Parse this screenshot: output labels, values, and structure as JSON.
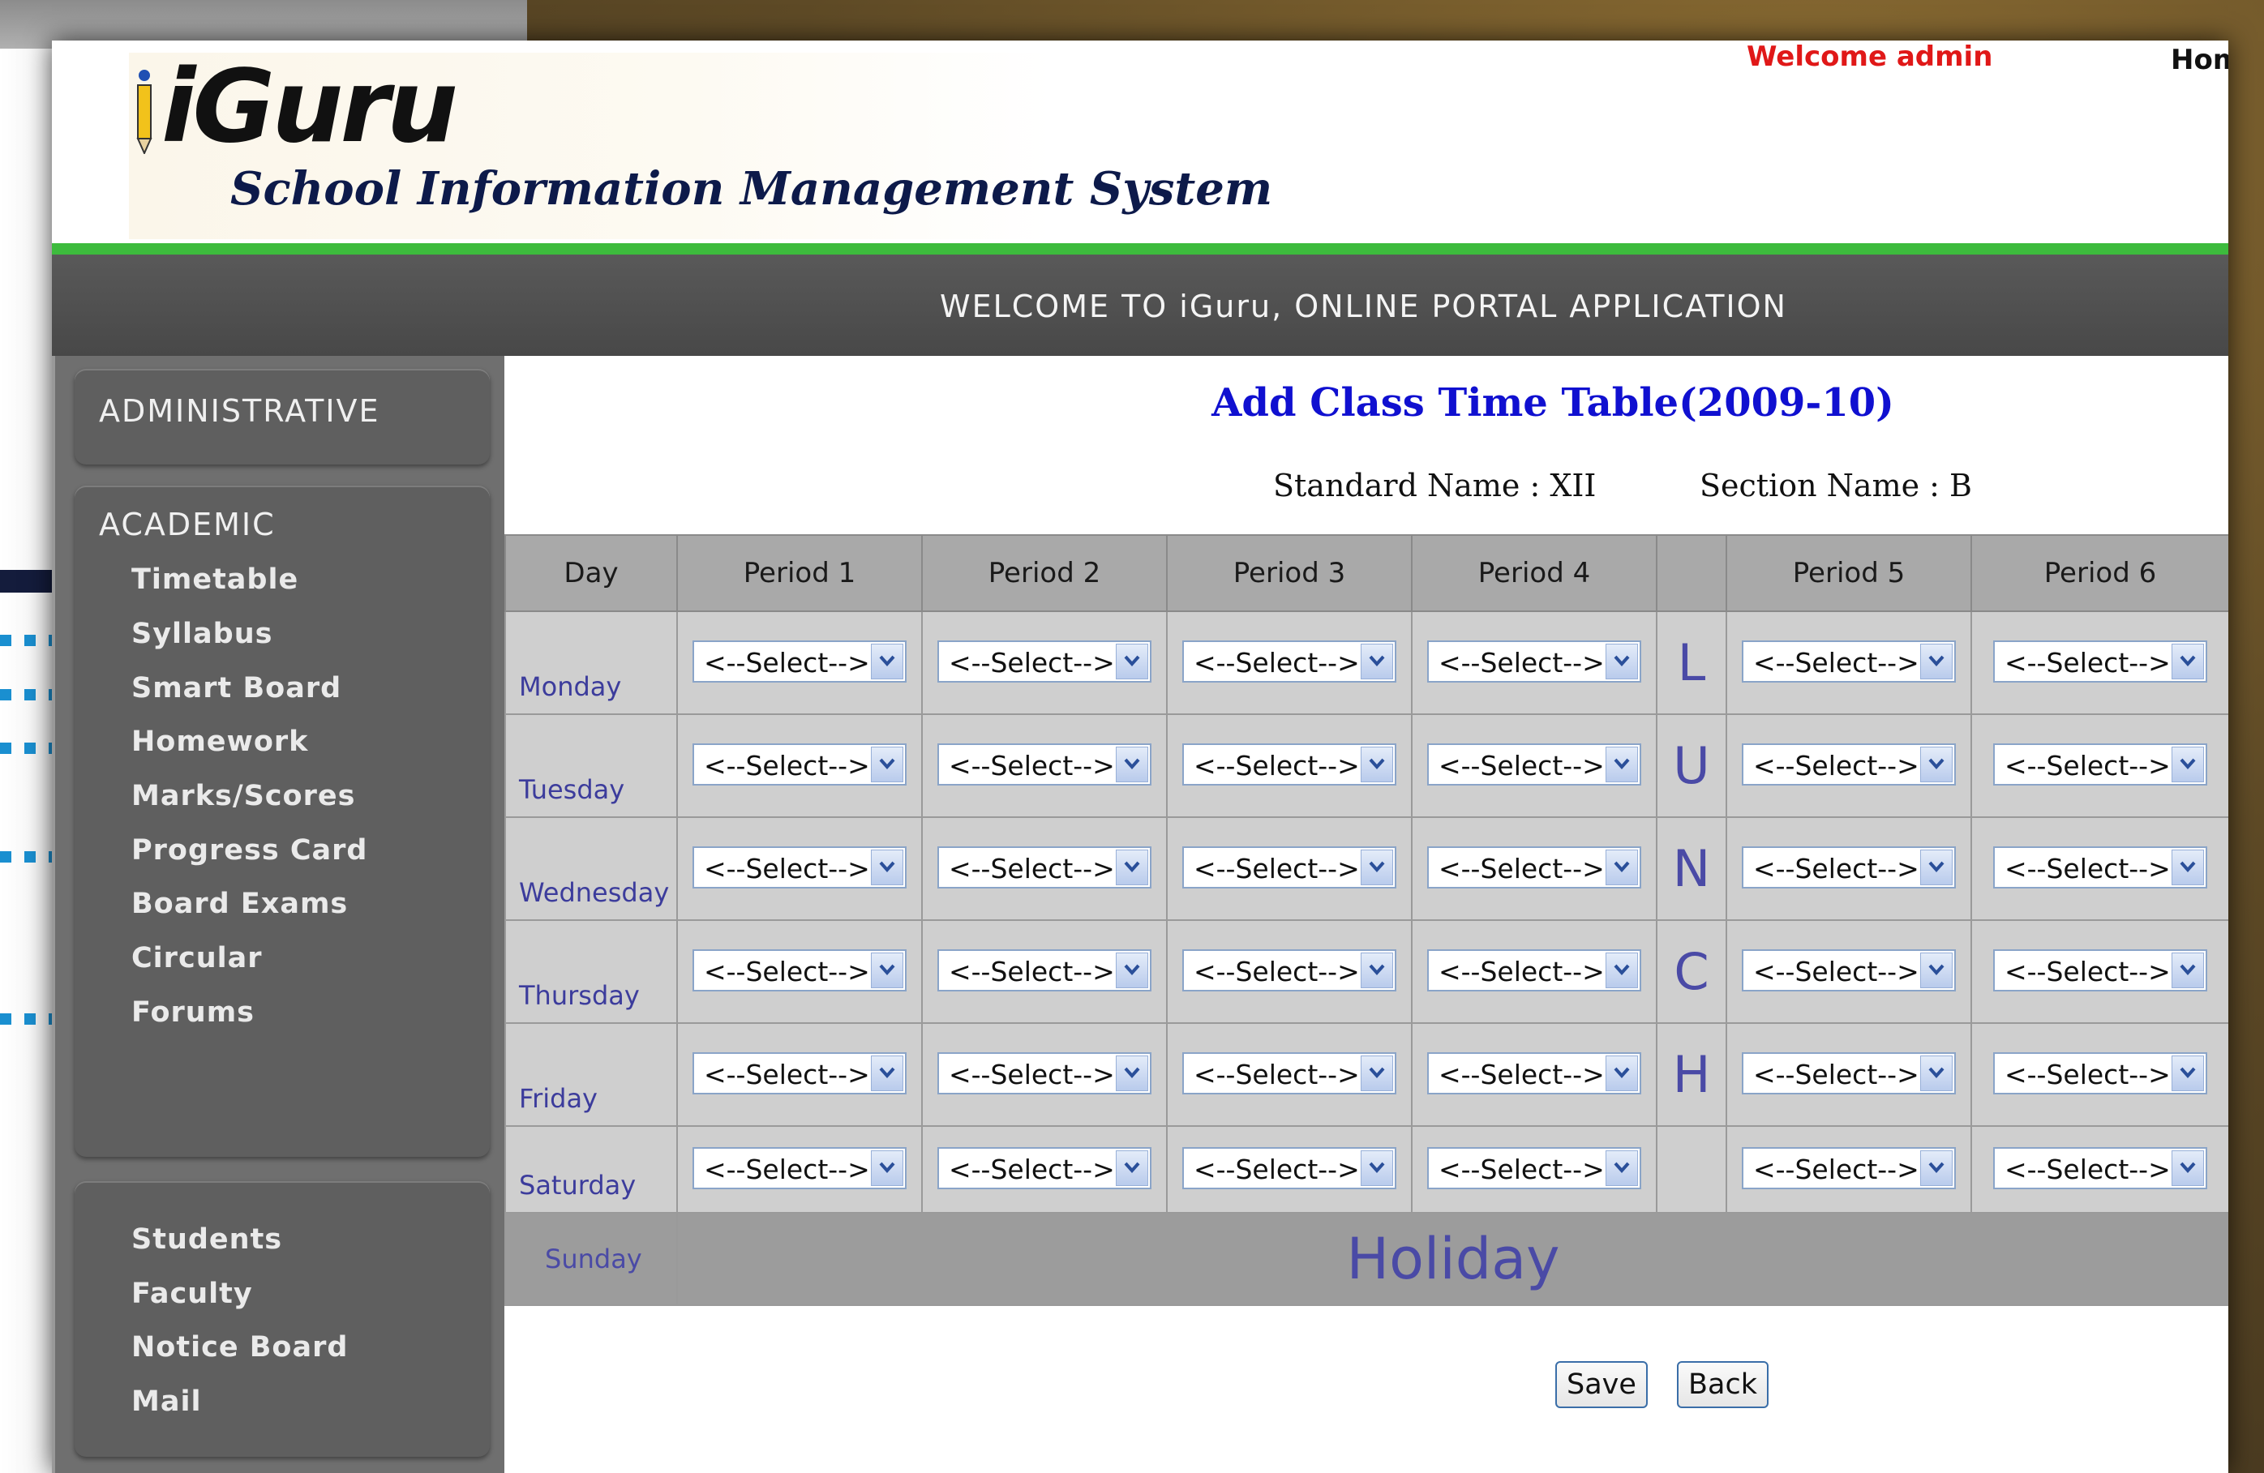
{
  "header": {
    "logo_text": "iGuru",
    "tagline": "School Information Management System",
    "welcome": "Welcome admin",
    "home": "Hom",
    "banner": "WELCOME TO iGuru, ONLINE PORTAL APPLICATION"
  },
  "sidebar": {
    "administrative": "ADMINISTRATIVE",
    "academic": "ACADEMIC",
    "academic_items": [
      "Timetable",
      "Syllabus",
      "Smart Board",
      "Homework",
      "Marks/Scores",
      "Progress Card",
      "Board Exams",
      "Circular",
      "Forums"
    ],
    "other_items": [
      "Students",
      "Faculty",
      "Notice Board",
      "Mail"
    ]
  },
  "main": {
    "title": "Add Class Time Table(2009-10)",
    "standard": "Standard Name : XII",
    "section": "Section Name : B",
    "columns": [
      "Day",
      "Period 1",
      "Period 2",
      "Period 3",
      "Period 4",
      "",
      "Period 5",
      "Period 6"
    ],
    "days": [
      "Monday",
      "Tuesday",
      "Wednesday",
      "Thursday",
      "Friday",
      "Saturday"
    ],
    "lunch_letters": [
      "L",
      "U",
      "N",
      "C",
      "H"
    ],
    "select_placeholder": "<--Select-->",
    "sunday": "Sunday",
    "holiday": "Holiday",
    "save": "Save",
    "back": "Back"
  },
  "colors": {
    "accent_green": "#3dbb3d",
    "title_blue": "#1010d0",
    "welcome_red": "#e01818",
    "active_arrow": "#f07d1f"
  }
}
